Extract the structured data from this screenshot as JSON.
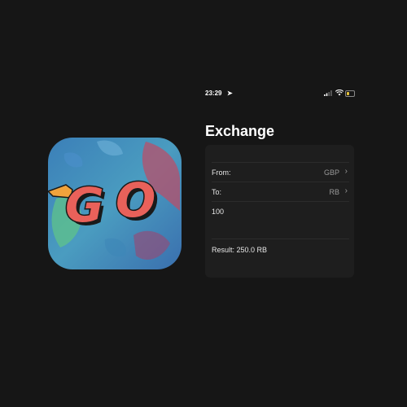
{
  "app_icon": {
    "name": "go-icon",
    "text": "GO"
  },
  "status_bar": {
    "time": "23:29"
  },
  "screen": {
    "title": "Exchange",
    "from": {
      "label": "From:",
      "value": "GBP"
    },
    "to": {
      "label": "To:",
      "value": "RB"
    },
    "amount": {
      "value": "100"
    },
    "result": {
      "label": "Result: 250.0 RB"
    }
  },
  "colors": {
    "background": "#161616",
    "card": "#1e1e1e",
    "go_letters": "#e9615a",
    "battery": "#e8c43b"
  }
}
